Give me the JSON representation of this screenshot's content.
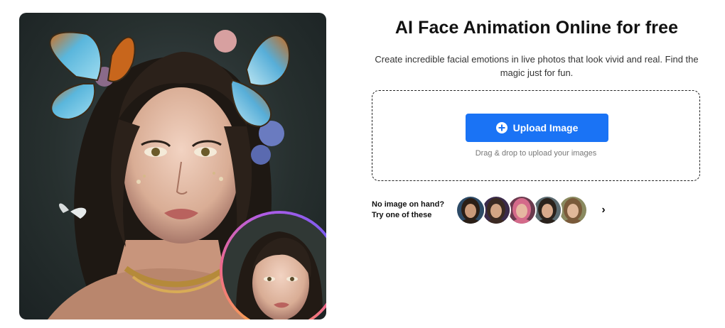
{
  "hero": {
    "image_alt": "Portrait of a young woman with dark hair and butterflies",
    "inset_alt": "Animated face preview"
  },
  "main": {
    "title": "AI Face Animation Online for free",
    "subtitle": "Create incredible facial emotions in live photos that look vivid and real. Find the magic just for fun."
  },
  "upload": {
    "button_label": "Upload Image",
    "button_icon": "plus-circle-icon",
    "drag_hint": "Drag & drop to upload your images"
  },
  "samples": {
    "label_line1": "No image on hand?",
    "label_line2": "Try one of these",
    "next_icon": "chevron-right-icon",
    "next_glyph": "›",
    "items": [
      {
        "name": "sample-1",
        "bg": "#2c4a66",
        "skin": "#c99a7a",
        "hair": "#2a1e16"
      },
      {
        "name": "sample-2",
        "bg": "#3a2a4a",
        "skin": "#d3a585",
        "hair": "#3b2a22"
      },
      {
        "name": "sample-3",
        "bg": "#6a3a4e",
        "skin": "#e6b7a1",
        "hair": "#d46a8a"
      },
      {
        "name": "sample-4",
        "bg": "#5a6a70",
        "skin": "#d8aa8c",
        "hair": "#2a221c"
      },
      {
        "name": "sample-5",
        "bg": "#8a8a60",
        "skin": "#e0b89a",
        "hair": "#7a5a3a"
      }
    ]
  },
  "colors": {
    "primary": "#1a73f5",
    "text": "#111111",
    "muted": "#777777"
  }
}
